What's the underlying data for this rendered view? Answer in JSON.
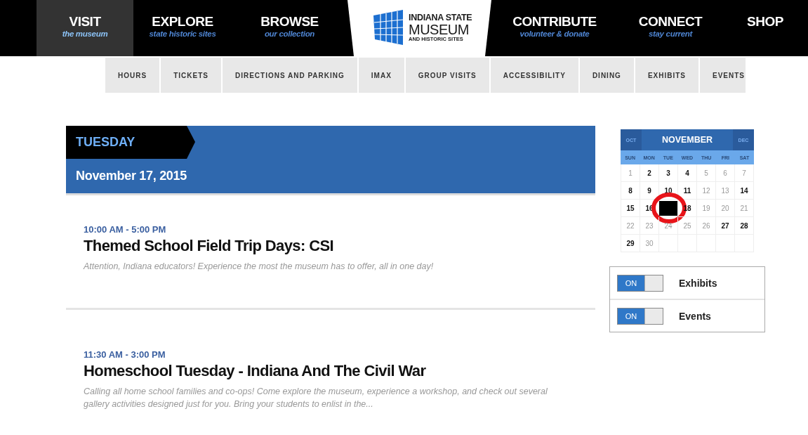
{
  "main_nav": [
    {
      "label": "VISIT",
      "sub": "the museum",
      "selected": true
    },
    {
      "label": "EXPLORE",
      "sub": "state historic sites",
      "selected": false
    },
    {
      "label": "BROWSE",
      "sub": "our collection",
      "selected": false
    },
    {
      "kind": "logo",
      "lines": [
        "INDIANA STATE",
        "MUSEUM",
        "AND HISTORIC SITES"
      ]
    },
    {
      "label": "CONTRIBUTE",
      "sub": "volunteer & donate",
      "selected": false
    },
    {
      "label": "CONNECT",
      "sub": "stay current",
      "selected": false
    },
    {
      "label": "SHOP",
      "selected": false
    }
  ],
  "sub_nav": [
    "HOURS",
    "TICKETS",
    "DIRECTIONS AND PARKING",
    "IMAX",
    "GROUP VISITS",
    "ACCESSIBILITY",
    "DINING",
    "EXHIBITS",
    "EVENTS"
  ],
  "day_header": {
    "weekday": "TUESDAY",
    "date": "November 17, 2015"
  },
  "events": [
    {
      "time": "10:00 AM - 5:00 PM",
      "title": "Themed School Field Trip Days: CSI",
      "summary": "Attention, Indiana educators! Experience the most the museum has to offer, all in one day!"
    },
    {
      "time": "11:30 AM - 3:00 PM",
      "title": "Homeschool Tuesday - Indiana And The Civil War",
      "summary": "Calling all home school families and co-ops! Come explore the museum, experience a workshop, and check out several gallery activities designed just for you.  Bring your students to enlist in the..."
    }
  ],
  "calendar": {
    "prev": "OCT",
    "month": "NOVEMBER",
    "next": "DEC",
    "weekdays": [
      "SUN",
      "MON",
      "TUE",
      "WED",
      "THU",
      "FRI",
      "SAT"
    ],
    "weeks": [
      [
        {
          "day": "1",
          "has_events": false
        },
        {
          "day": "2",
          "has_events": true
        },
        {
          "day": "3",
          "has_events": true
        },
        {
          "day": "4",
          "has_events": true
        },
        {
          "day": "5",
          "has_events": false
        },
        {
          "day": "6",
          "has_events": false
        },
        {
          "day": "7",
          "has_events": false
        }
      ],
      [
        {
          "day": "8",
          "has_events": true
        },
        {
          "day": "9",
          "has_events": true
        },
        {
          "day": "10",
          "has_events": true
        },
        {
          "day": "11",
          "has_events": true
        },
        {
          "day": "12",
          "has_events": false
        },
        {
          "day": "13",
          "has_events": false
        },
        {
          "day": "14",
          "has_events": true
        }
      ],
      [
        {
          "day": "15",
          "has_events": true
        },
        {
          "day": "16",
          "has_events": true
        },
        {
          "redacted": true,
          "circled": true
        },
        {
          "day": "18",
          "has_events": true
        },
        {
          "day": "19",
          "has_events": false
        },
        {
          "day": "20",
          "has_events": false
        },
        {
          "day": "21",
          "has_events": false
        }
      ],
      [
        {
          "day": "22",
          "has_events": false
        },
        {
          "day": "23",
          "has_events": false
        },
        {
          "day": "24",
          "has_events": false
        },
        {
          "day": "25",
          "has_events": false
        },
        {
          "day": "26",
          "has_events": false
        },
        {
          "day": "27",
          "has_events": true
        },
        {
          "day": "28",
          "has_events": true
        }
      ],
      [
        {
          "day": "29",
          "has_events": true
        },
        {
          "day": "30",
          "has_events": false
        }
      ]
    ]
  },
  "filters": [
    {
      "label": "Exhibits",
      "on": true,
      "state_label": "ON"
    },
    {
      "label": "Events",
      "on": true,
      "state_label": "ON"
    }
  ]
}
